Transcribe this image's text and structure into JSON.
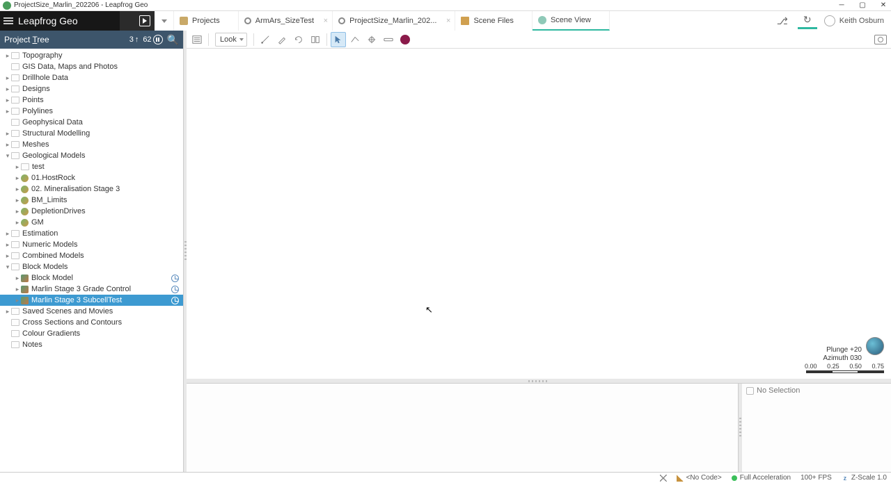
{
  "window": {
    "title": "ProjectSize_Marlin_202206 - Leapfrog Geo"
  },
  "header": {
    "app_name": "Leapfrog Geo"
  },
  "tabs": {
    "projects": "Projects",
    "arm": "ArmArs_SizeTest",
    "proj": "ProjectSize_Marlin_202...",
    "scene_files": "Scene Files",
    "scene_view": "Scene View"
  },
  "user": {
    "name": "Keith Osburn"
  },
  "tree_header": {
    "title_pre": "Project ",
    "title_u": "T",
    "title_post": "ree",
    "num_a": "3",
    "num_b": "62"
  },
  "tree": {
    "topography": "Topography",
    "gis": "GIS Data, Maps and Photos",
    "drillhole": "Drillhole Data",
    "designs": "Designs",
    "points": "Points",
    "polylines": "Polylines",
    "geophys": "Geophysical Data",
    "struct": "Structural Modelling",
    "meshes": "Meshes",
    "geomodels": "Geological Models",
    "gm_test": "test",
    "gm_host": "01.HostRock",
    "gm_min": "02. Mineralisation Stage 3",
    "gm_bm": "BM_Limits",
    "gm_dep": "DepletionDrives",
    "gm_gm": "GM",
    "estimation": "Estimation",
    "numeric": "Numeric Models",
    "combined": "Combined Models",
    "blockmodels": "Block Models",
    "bm_block": "Block Model",
    "bm_grade": "Marlin Stage 3 Grade Control",
    "bm_subcell": "Marlin Stage 3 SubcellTest",
    "saved": "Saved Scenes and Movies",
    "cross": "Cross Sections and Contours",
    "gradients": "Colour Gradients",
    "notes": "Notes"
  },
  "toolbar": {
    "look": "Look"
  },
  "compass": {
    "plunge": "Plunge  +20",
    "azimuth": "Azimuth  030",
    "s0": "0.00",
    "s1": "0.25",
    "s2": "0.50",
    "s3": "0.75"
  },
  "panels": {
    "no_selection": "No Selection"
  },
  "status": {
    "nocode": "<No Code>",
    "accel": "Full Acceleration",
    "fps": "100+ FPS",
    "zscale": "Z-Scale 1.0"
  }
}
